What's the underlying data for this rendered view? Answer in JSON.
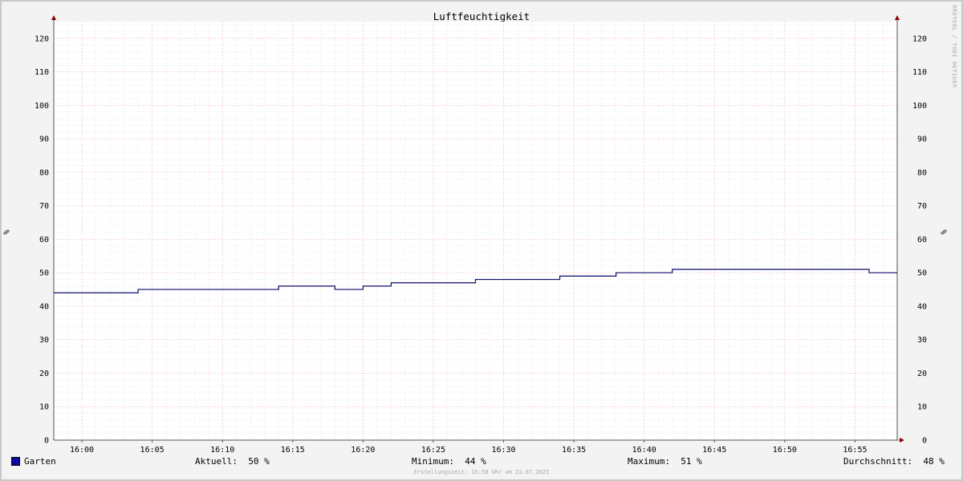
{
  "chart_data": {
    "type": "line",
    "title": "Luftfeuchtigkeit",
    "ylabel": "%",
    "ylabel_right": "%",
    "ylim": [
      0,
      125
    ],
    "y_ticks": [
      0,
      10,
      20,
      30,
      40,
      50,
      60,
      70,
      80,
      90,
      100,
      110,
      120
    ],
    "xlim": [
      "15:58",
      "16:58"
    ],
    "x_ticks": [
      "16:00",
      "16:05",
      "16:10",
      "16:15",
      "16:20",
      "16:25",
      "16:30",
      "16:35",
      "16:40",
      "16:45",
      "16:50",
      "16:55"
    ],
    "grid": true,
    "step": true,
    "series": [
      {
        "name": "Garten",
        "color": "#0b0b6b",
        "x": [
          "15:58",
          "16:04",
          "16:14",
          "16:18",
          "16:20",
          "16:22",
          "16:28",
          "16:34",
          "16:38",
          "16:42",
          "16:56"
        ],
        "values": [
          44,
          45,
          46,
          45,
          46,
          47,
          48,
          49,
          50,
          51,
          50
        ]
      }
    ],
    "legend": {
      "name": "Garten",
      "swatch_color": "#0b0ba0",
      "stats": [
        {
          "label": "Aktuell:",
          "value": "50 %"
        },
        {
          "label": "Minimum:",
          "value": "44 %"
        },
        {
          "label": "Maximum:",
          "value": "51 %"
        },
        {
          "label": "Durchschnitt:",
          "value": "48 %"
        }
      ]
    },
    "watermark": "RRDTOOL / TOBI OETIKER",
    "footer": "Erstellungszeit: 16:58 Uhr am 22.07.2025"
  }
}
